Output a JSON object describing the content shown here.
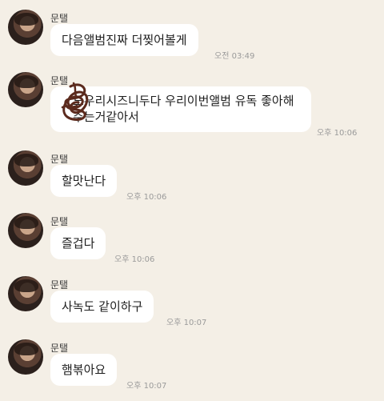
{
  "messages": [
    {
      "sender": "문탤",
      "text": "다음앨범진짜 더찢어볼게",
      "time": "오전 03:49"
    },
    {
      "sender": "문탤",
      "text": "도우리시즈니두다 우리이번앨범 유독 좋아해주는거같아서",
      "time": "오후 10:06"
    },
    {
      "sender": "문탤",
      "text": "할맛난다",
      "time": "오후 10:06"
    },
    {
      "sender": "문탤",
      "text": "즐겁다",
      "time": "오후 10:06"
    },
    {
      "sender": "문탤",
      "text": "사녹도 같이하구",
      "time": "오후 10:07"
    },
    {
      "sender": "문탤",
      "text": "햄볶아요",
      "time": "오후 10:07"
    }
  ],
  "colors": {
    "background": "#f4efe6",
    "bubble": "#ffffff",
    "scribble": "#5b2a1d"
  }
}
